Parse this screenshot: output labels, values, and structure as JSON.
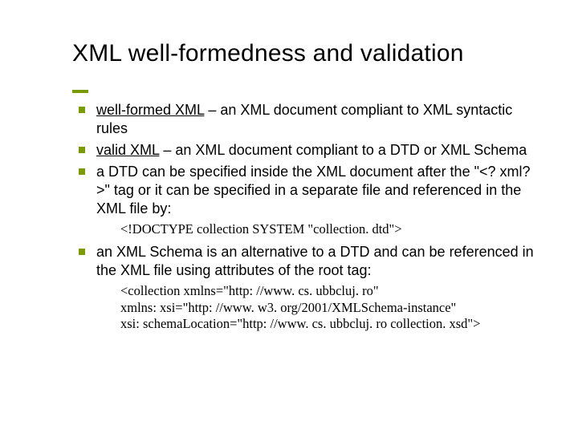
{
  "title": "XML well-formedness and validation",
  "items": [
    {
      "term": "well-formed XML",
      "rest": " – an XML document compliant to XML syntactic rules"
    },
    {
      "term": "valid XML",
      "rest": " – an XML document compliant to a DTD or XML Schema"
    },
    {
      "plain": "a DTD can be specified inside the XML document after the \"<? xml? >\" tag or it can be specified in a separate file and referenced in the XML file by:"
    }
  ],
  "code1": "<!DOCTYPE collection SYSTEM \"collection. dtd\">",
  "item4": "an XML Schema is an alternative to a DTD and can be referenced in the XML file using attributes of the root tag:",
  "code2a": "<collection xmlns=\"http: //www. cs. ubbcluj. ro\"",
  "code2b": "  xmlns: xsi=\"http: //www. w3. org/2001/XMLSchema-instance\"",
  "code2c": "  xsi: schemaLocation=\"http: //www. cs. ubbcluj. ro collection. xsd\">"
}
